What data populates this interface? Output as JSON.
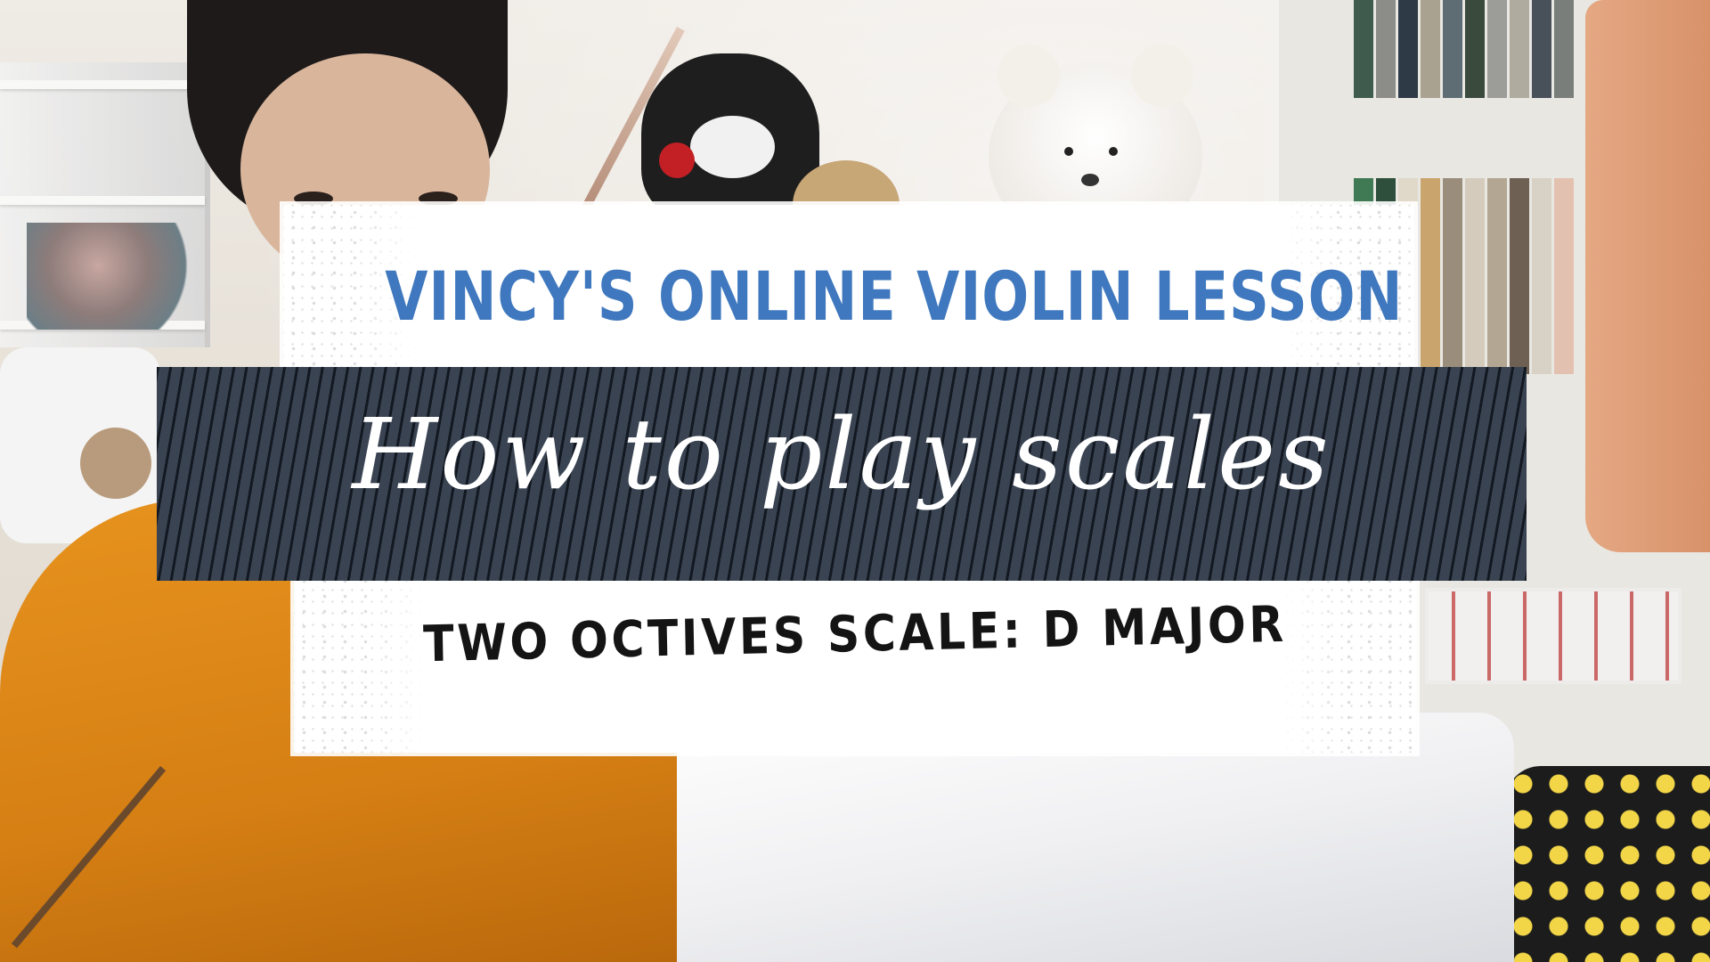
{
  "overlay": {
    "heading": "VINCY'S ONLINE VIOLIN LESSON",
    "script_title": "How to play scales",
    "subheading": "TWO OCTIVES SCALE: D MAJOR"
  },
  "colors": {
    "heading_blue": "#3f78be",
    "band_slate": "#394352",
    "card_white": "#ffffff",
    "subheading_black": "#141414",
    "shirt_orange": "#e7931e"
  }
}
